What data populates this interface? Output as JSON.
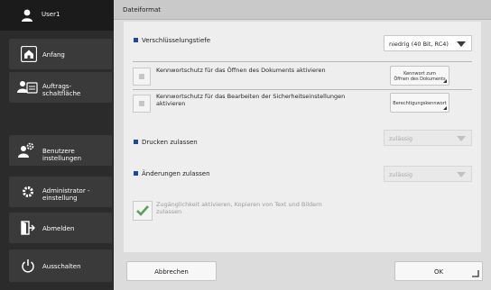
{
  "sidebar": {
    "user": "User1",
    "items": [
      {
        "label": "Anfang",
        "icon": "home-icon"
      },
      {
        "label": "Auftrags-\nschaltfläche",
        "icon": "job-status-icon"
      },
      {
        "label": "Benutzere instellungen",
        "icon": "user-settings-icon"
      },
      {
        "label": "Administrator -\neinstellung",
        "icon": "admin-settings-icon"
      },
      {
        "label": "Abmelden",
        "icon": "logout-icon"
      },
      {
        "label": "Ausschalten",
        "icon": "power-icon"
      }
    ]
  },
  "main": {
    "title": "Dateiformat",
    "encryption_label": "Verschlüsselungstiefe",
    "encryption_value": "niedrig (40 Bit, RC4)",
    "open_pw_label": "Kennwortschutz für das Öffnen des Dokuments aktivieren",
    "open_pw_button": "Kennwort zum\nÖffnen des Dokuments",
    "edit_pw_label": "Kennwortschutz für das Bearbeiten der Sicherheitseinstellungen\naktivieren",
    "edit_pw_button": "Berechtigungskennwort",
    "print_label": "Drucken zulassen",
    "print_value": "zulässig",
    "changes_label": "Änderungen zulassen",
    "changes_value": "zulässig",
    "accessibility_label": "Zugänglichkeit aktivieren, Kopieren von Text und Bildern\nzulassen",
    "cancel_label": "Abbrechen",
    "ok_label": "OK"
  },
  "colors": {
    "accent": "#1c47a6",
    "sidebar_bg": "#2b2b2b",
    "sidebar_button": "#3a3a3a",
    "check_green": "#5aa05a"
  }
}
